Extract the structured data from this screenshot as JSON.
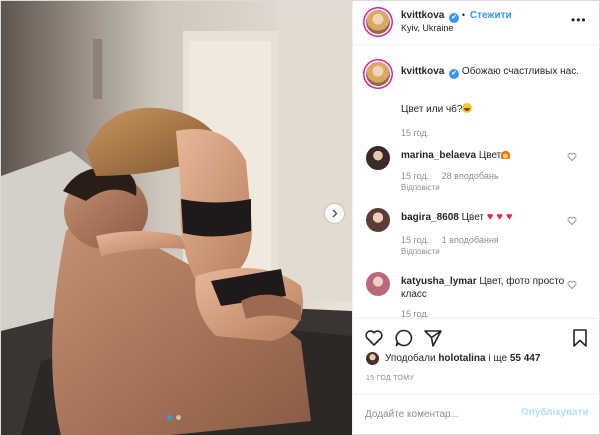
{
  "post": {
    "username": "kvittkova",
    "verified_mark": "✔",
    "separator": "•",
    "follow_label": "Стежити",
    "location": "Kyiv, Ukraine",
    "more_icon": "more-horizontal-icon",
    "slides_total": 2,
    "slide_active": 1
  },
  "caption": {
    "username": "kvittkova",
    "text_line1": "Обожаю счастливых нас.",
    "text_line2": "Цвет или чб?",
    "time": "15 год."
  },
  "comments": [
    {
      "username": "marina_belaeva",
      "text": "Цвет",
      "emoji": "fire",
      "time": "15 год.",
      "likes": "28 вподобань",
      "reply": "Відповісти"
    },
    {
      "username": "bagira_8608",
      "text": "Цвет",
      "emoji": "red-hearts",
      "hearts": "♥ ♥ ♥",
      "time": "15 год.",
      "likes": "1 вподобання",
      "reply": "Відповісти"
    },
    {
      "username": "katyusha_lymar",
      "text": "Цвет, фото просто класс",
      "time": "15 год."
    }
  ],
  "actions": {
    "like_icon": "heart-outline-icon",
    "comment_icon": "comment-bubble-icon",
    "share_icon": "paper-plane-icon",
    "save_icon": "bookmark-icon"
  },
  "likes": {
    "prefix": "Уподобали",
    "user": "holotalina",
    "middle": "і ще",
    "count": "55 447"
  },
  "timeago": "15 ГОД ТОМУ",
  "add_comment": {
    "placeholder": "Додайте коментар...",
    "publish_label": "Опублікувати"
  },
  "colors": {
    "link_blue": "#3897f0",
    "publish_disabled": "#b2dffc",
    "muted_text": "#8e8e8e",
    "heart_red": "#e0245e"
  }
}
